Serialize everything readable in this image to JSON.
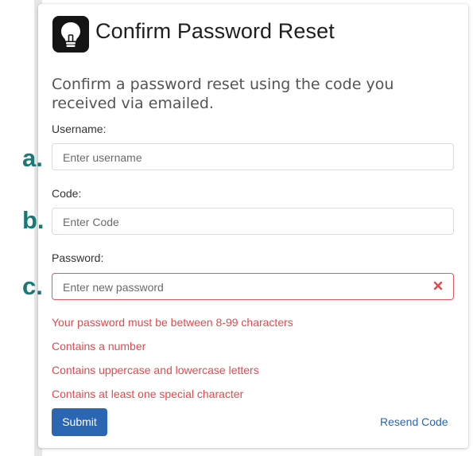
{
  "header": {
    "title": "Confirm Password Reset",
    "logo_icon": "lightbulb-icon"
  },
  "subtitle": "Confirm a password reset using the code you received via emailed.",
  "annotations": {
    "a": "a.",
    "b": "b.",
    "c": "c.",
    "color": "#187a73"
  },
  "form": {
    "username": {
      "label": "Username:",
      "placeholder": "Enter username"
    },
    "code": {
      "label": "Code:",
      "placeholder": "Enter Code"
    },
    "password": {
      "label": "Password:",
      "placeholder": "Enter new password",
      "clear_icon": "close-icon"
    }
  },
  "errors": [
    "Your password must be between 8-99 characters",
    "Contains a number",
    "Contains uppercase and lowercase letters",
    "Contains at least one special character"
  ],
  "actions": {
    "submit_label": "Submit",
    "resend_label": "Resend Code"
  },
  "colors": {
    "primary": "#2a66b1",
    "error": "#e5484d",
    "marker": "#187a73"
  }
}
